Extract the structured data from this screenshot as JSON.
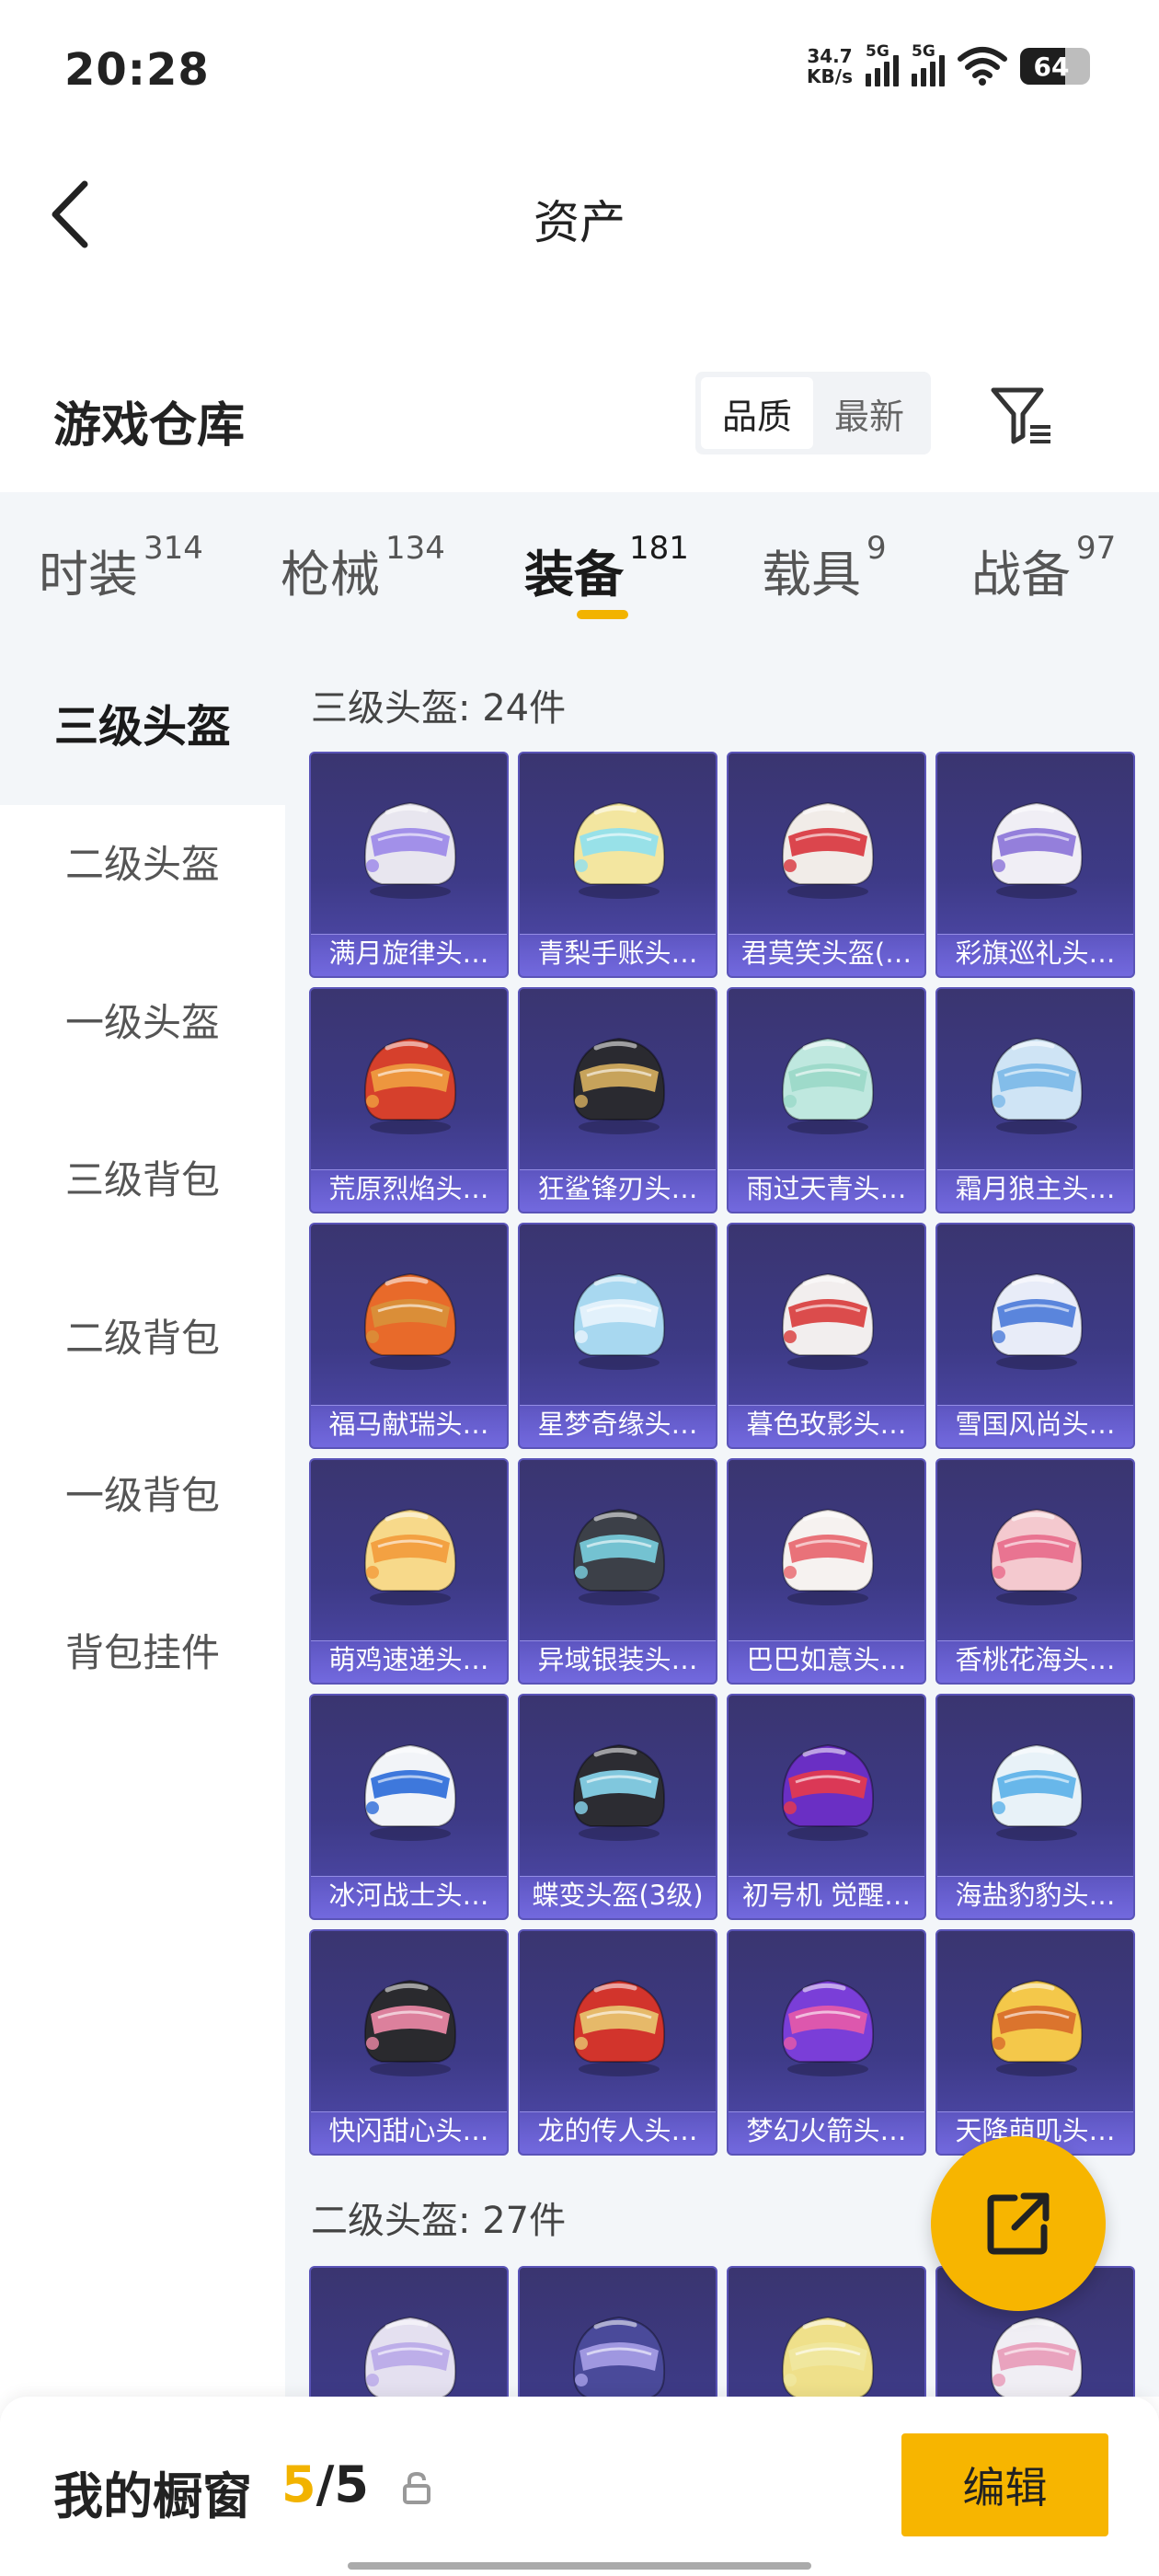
{
  "status_bar": {
    "time": "20:28",
    "net_speed_value": "34.7",
    "net_speed_unit": "KB/s",
    "signal_1_label": "5G",
    "signal_2_label": "5G",
    "battery": "64",
    "battery_level": 0.64
  },
  "header": {
    "title": "资产"
  },
  "warehouse": {
    "title": "游戏仓库",
    "sort_options": [
      "品质",
      "最新"
    ],
    "active_sort": "品质"
  },
  "category_tabs": [
    {
      "label": "时装",
      "count": "314"
    },
    {
      "label": "枪械",
      "count": "134"
    },
    {
      "label": "装备",
      "count": "181",
      "active": true
    },
    {
      "label": "载具",
      "count": "9"
    },
    {
      "label": "战备",
      "count": "97"
    }
  ],
  "sidebar": {
    "items": [
      "三级头盔",
      "二级头盔",
      "一级头盔",
      "三级背包",
      "二级背包",
      "一级背包",
      "背包挂件"
    ],
    "active": "三级头盔"
  },
  "groups": [
    {
      "label": "三级头盔: 24件",
      "items": [
        "满月旋律头…",
        "青梨手账头…",
        "君莫笑头盔(…",
        "彩旗巡礼头…",
        "荒原烈焰头…",
        "狂鲨锋刃头…",
        "雨过天青头…",
        "霜月狼主头…",
        "福马献瑞头…",
        "星梦奇缘头…",
        "暮色玫影头…",
        "雪国风尚头…",
        "萌鸡速递头…",
        "异域银装头…",
        "巴巴如意头…",
        "香桃花海头…",
        "冰河战士头…",
        "蝶变头盔(3级)",
        "初号机 觉醒…",
        "海盐豹豹头…",
        "快闪甜心头…",
        "龙的传人头…",
        "梦幻火箭头…",
        "天降萌叽头…"
      ]
    },
    {
      "label": "二级头盔: 27件",
      "items": [
        "",
        "",
        "",
        ""
      ]
    }
  ],
  "helmet_colors": [
    "#e8e6ef",
    "#f3e6a0",
    "#f1ece8",
    "#f0eef5",
    "#d6402c",
    "#2a2a30",
    "#bfe8df",
    "#cfe4f5",
    "#e86a2a",
    "#a8d8f0",
    "#f2eeee",
    "#e8ecf8",
    "#f7d98a",
    "#3c4048",
    "#f6f2f0",
    "#f4c9cf",
    "#f2f4f8",
    "#2c2c32",
    "#6a2fc4",
    "#e8f2f8",
    "#2a2a2e",
    "#d2342c",
    "#7a3ed8",
    "#f4c84a",
    "#e4e0f0",
    "#4a4a9a",
    "#efe08a",
    "#f0eef4"
  ],
  "accent_colors": [
    "#9a86e8",
    "#8ee0f0",
    "#d8343c",
    "#8a72d8",
    "#f0a040",
    "#d8b060",
    "#9ad8c8",
    "#7ab8e8",
    "#d8923a",
    "#e8f4fc",
    "#d83a3a",
    "#4a7ad8",
    "#f29a3a",
    "#7ad0e0",
    "#e8646c",
    "#e86a8a",
    "#2a6ad8",
    "#8ad8f0",
    "#e83a4a",
    "#5ab0e8",
    "#f08aa8",
    "#e8c870",
    "#e85aa8",
    "#d86a2a",
    "#b8a8e8",
    "#a8a0e8",
    "#f0e8a0",
    "#e89ab8"
  ],
  "bottom": {
    "showcase_label": "我的橱窗",
    "count_current": "5",
    "count_sep": "/",
    "count_total": "5",
    "edit_label": "编辑"
  },
  "icons": {
    "back": "chevron-left-icon",
    "filter": "filter-icon",
    "share": "share-icon",
    "lock": "lock-icon"
  },
  "colors": {
    "accent": "#f7b500",
    "card_bg": "#3d3a86",
    "panel_bg": "#f3f6f9"
  }
}
